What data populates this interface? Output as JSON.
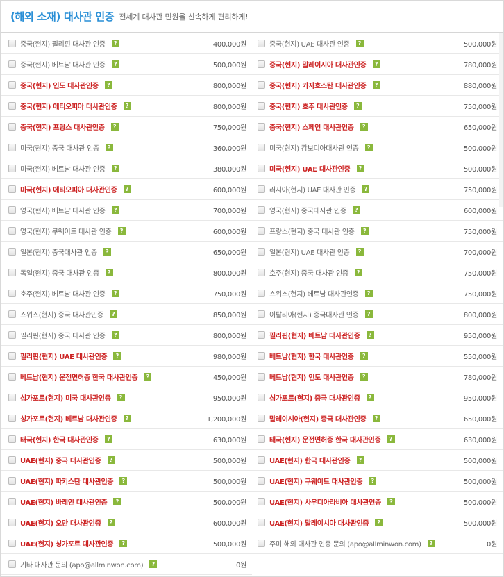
{
  "header": {
    "title": "(해외 소재) 대사관 인증",
    "subtitle": "전세계 대사관 민원을 신속하게 편리하게!"
  },
  "help_icon": "?",
  "items": [
    {
      "name": "중국(현지) 필리핀 대사관 인증",
      "price": "400,000원",
      "red": false
    },
    {
      "name": "중국(현지) UAE 대사관 인증",
      "price": "500,000원",
      "red": false
    },
    {
      "name": "중국(현지) 베트남 대사관 인증",
      "price": "500,000원",
      "red": false
    },
    {
      "name": "중국(현지) 말레이시아 대사관인증",
      "price": "780,000원",
      "red": true
    },
    {
      "name": "중국(현지) 인도 대사관인증",
      "price": "800,000원",
      "red": true
    },
    {
      "name": "중국(현지) 카자흐스탄 대사관인증",
      "price": "880,000원",
      "red": true
    },
    {
      "name": "중국(현지) 에티오피아 대사관인증",
      "price": "800,000원",
      "red": true
    },
    {
      "name": "중국(현지) 호주 대사관인증",
      "price": "750,000원",
      "red": true
    },
    {
      "name": "중국(현지) 프랑스 대사관인증",
      "price": "750,000원",
      "red": true
    },
    {
      "name": "중국(현지) 스페인 대사관인증",
      "price": "650,000원",
      "red": true
    },
    {
      "name": "미국(현지) 중국 대사관 인증",
      "price": "360,000원",
      "red": false
    },
    {
      "name": "미국(현지) 캄보디아대사관 인증",
      "price": "500,000원",
      "red": false
    },
    {
      "name": "미국(현지) 베트남 대사관 인증",
      "price": "380,000원",
      "red": false
    },
    {
      "name": "미국(현지) UAE 대사관인증",
      "price": "500,000원",
      "red": true
    },
    {
      "name": "미국(현지) 에티오피아 대사관인증",
      "price": "600,000원",
      "red": true
    },
    {
      "name": "러시아(현지) UAE 대사관 인증",
      "price": "750,000원",
      "red": false
    },
    {
      "name": "영국(현지) 베트남 대사관 인증",
      "price": "700,000원",
      "red": false
    },
    {
      "name": "영국(현지) 중국대사관 인증",
      "price": "600,000원",
      "red": false
    },
    {
      "name": "영국(현지) 쿠웨이트 대사관 인증",
      "price": "600,000원",
      "red": false
    },
    {
      "name": "프랑스(현지) 중국 대사관 인증",
      "price": "750,000원",
      "red": false
    },
    {
      "name": "일본(현지) 중국대사관 인증",
      "price": "650,000원",
      "red": false
    },
    {
      "name": "일본(현지) UAE 대사관 인증",
      "price": "700,000원",
      "red": false
    },
    {
      "name": "독일(현지) 중국 대사관 인증",
      "price": "800,000원",
      "red": false
    },
    {
      "name": "호주(현지) 중국 대사관 인증",
      "price": "750,000원",
      "red": false
    },
    {
      "name": "호주(현지) 베트남 대사관 인증",
      "price": "750,000원",
      "red": false
    },
    {
      "name": "스위스(현지) 베트남 대사관인증",
      "price": "750,000원",
      "red": false
    },
    {
      "name": "스위스(현지) 중국 대사관인증",
      "price": "850,000원",
      "red": false
    },
    {
      "name": "이탈리아(현지) 중국대사관 인증",
      "price": "800,000원",
      "red": false
    },
    {
      "name": "필리핀(현지) 중국 대사관 인증",
      "price": "800,000원",
      "red": false
    },
    {
      "name": "필리핀(현지) 베트남 대사관인증",
      "price": "950,000원",
      "red": true
    },
    {
      "name": "필리핀(현지) UAE 대사관인증",
      "price": "980,000원",
      "red": true
    },
    {
      "name": "베트남(현지) 한국 대사관인증",
      "price": "550,000원",
      "red": true
    },
    {
      "name": "베트남(현지) 운전면허증 한국 대사관인증",
      "price": "450,000원",
      "red": true
    },
    {
      "name": "베트남(현지) 인도 대사관인증",
      "price": "780,000원",
      "red": true
    },
    {
      "name": "싱가포르(현지) 미국 대사관인증",
      "price": "950,000원",
      "red": true
    },
    {
      "name": "싱가포르(현지) 중국 대사관인증",
      "price": "950,000원",
      "red": true
    },
    {
      "name": "싱가포르(현지) 베트남 대사관인증",
      "price": "1,200,000원",
      "red": true
    },
    {
      "name": "말레이시아(현지) 중국 대사관인증",
      "price": "650,000원",
      "red": true
    },
    {
      "name": "태국(현지) 한국 대사관인증",
      "price": "630,000원",
      "red": true
    },
    {
      "name": "태국(현지) 운전면허증 한국 대사관인증",
      "price": "630,000원",
      "red": true
    },
    {
      "name": "UAE(현지) 중국 대사관인증",
      "price": "500,000원",
      "red": true
    },
    {
      "name": "UAE(현지) 한국 대사관인증",
      "price": "500,000원",
      "red": true
    },
    {
      "name": "UAE(현지) 파키스탄 대사관인증",
      "price": "500,000원",
      "red": true
    },
    {
      "name": "UAE(현지) 쿠웨이트 대사관인증",
      "price": "500,000원",
      "red": true
    },
    {
      "name": "UAE(현지) 바레인 대사관인증",
      "price": "500,000원",
      "red": true
    },
    {
      "name": "UAE(현지) 사우디아라비아 대사관인증",
      "price": "500,000원",
      "red": true
    },
    {
      "name": "UAE(현지) 오만 대사관인증",
      "price": "600,000원",
      "red": true
    },
    {
      "name": "UAE(현지) 말레이시아 대사관인증",
      "price": "500,000원",
      "red": true
    },
    {
      "name": "UAE(현지) 싱가포르 대사관인증",
      "price": "500,000원",
      "red": true
    },
    {
      "name": "주미 해외 대사관 인증 문의 (apo@allminwon.com)",
      "price": "0원",
      "red": false
    },
    {
      "name": "기타 대사관 문의 (apo@allminwon.com)",
      "price": "0원",
      "red": false
    }
  ],
  "colors": {
    "title": "#2a8fd6",
    "highlight": "#cc2222",
    "help_badge": "#8ab83c"
  }
}
